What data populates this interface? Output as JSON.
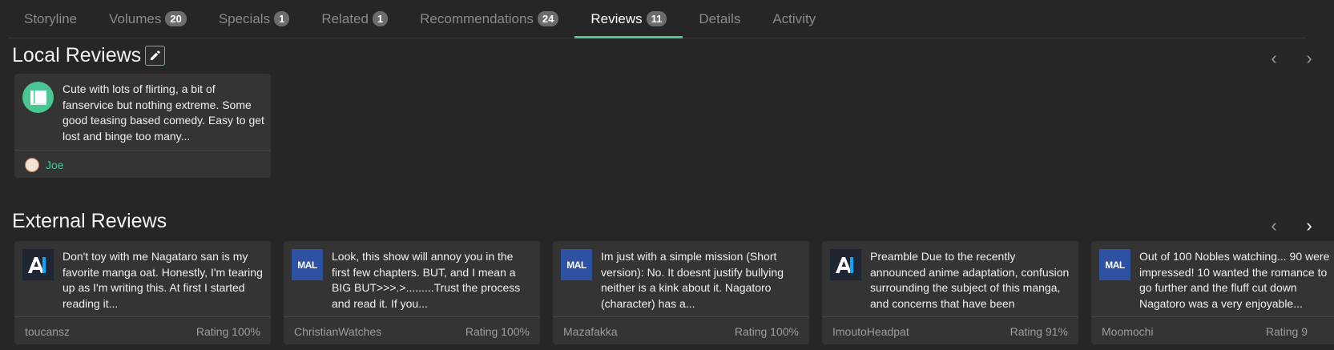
{
  "tabs": [
    {
      "label": "Storyline",
      "count": ""
    },
    {
      "label": "Volumes",
      "count": "20"
    },
    {
      "label": "Specials",
      "count": "1"
    },
    {
      "label": "Related",
      "count": "1"
    },
    {
      "label": "Recommendations",
      "count": "24"
    },
    {
      "label": "Reviews",
      "count": "11",
      "active": true
    },
    {
      "label": "Details",
      "count": ""
    },
    {
      "label": "Activity",
      "count": ""
    }
  ],
  "local_reviews": {
    "title": "Local Reviews",
    "cards": [
      {
        "text": "Cute with lots of flirting, a bit of fanservice but nothing extreme. Some good teasing based comedy. Easy to get lost and binge too many...",
        "user": "Joe"
      }
    ]
  },
  "external_reviews": {
    "title": "External Reviews",
    "cards": [
      {
        "source": "AL",
        "text": "Don't toy with me Nagataro san is my favorite manga oat. Honestly, I'm tearing up as I'm writing this. At first I started reading it...",
        "user": "toucansz",
        "rating": "Rating 100%"
      },
      {
        "source": "MAL",
        "text": "Look, this show will annoy you in the first few chapters. BUT, and I mean a BIG BUT>>>.>.........Trust the process and read it. If you...",
        "user": "ChristianWatches",
        "rating": "Rating 100%"
      },
      {
        "source": "MAL",
        "text": "Im just with a simple mission (Short version): No. It doesnt justify bullying neither is a kink about it. Nagatoro (character) has a...",
        "user": "Mazafakka",
        "rating": "Rating 100%"
      },
      {
        "source": "AL",
        "text": "Preamble Due to the recently announced anime adaptation, confusion surrounding the subject of this manga, and concerns that have been",
        "user": "ImoutoHeadpat",
        "rating": "Rating 91%"
      },
      {
        "source": "MAL",
        "text": "Out of 100 Nobles watching... 90 were impressed! 10 wanted the romance to go further and the fluff cut down Nagatoro was a very enjoyable...",
        "user": "Moomochi",
        "rating": "Rating 9"
      }
    ]
  },
  "mal_label": "MAL"
}
